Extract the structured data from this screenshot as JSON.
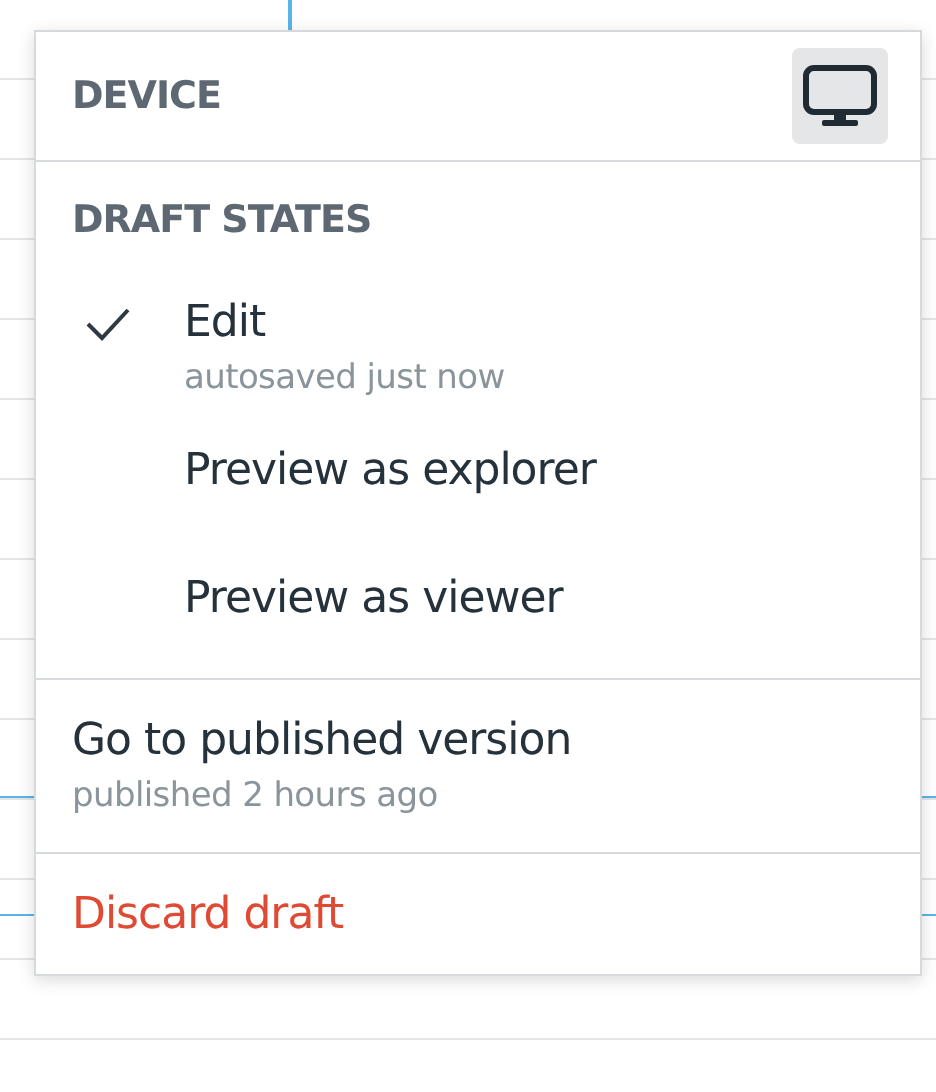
{
  "device": {
    "label": "DEVICE",
    "selected": true
  },
  "draft_states": {
    "label": "DRAFT STATES",
    "items": [
      {
        "label": "Edit",
        "subtitle": "autosaved just now",
        "selected": true
      },
      {
        "label": "Preview as explorer",
        "selected": false
      },
      {
        "label": "Preview as viewer",
        "selected": false
      }
    ]
  },
  "published": {
    "label": "Go to published version",
    "subtitle": "published 2 hours ago"
  },
  "discard": {
    "label": "Discard draft"
  }
}
